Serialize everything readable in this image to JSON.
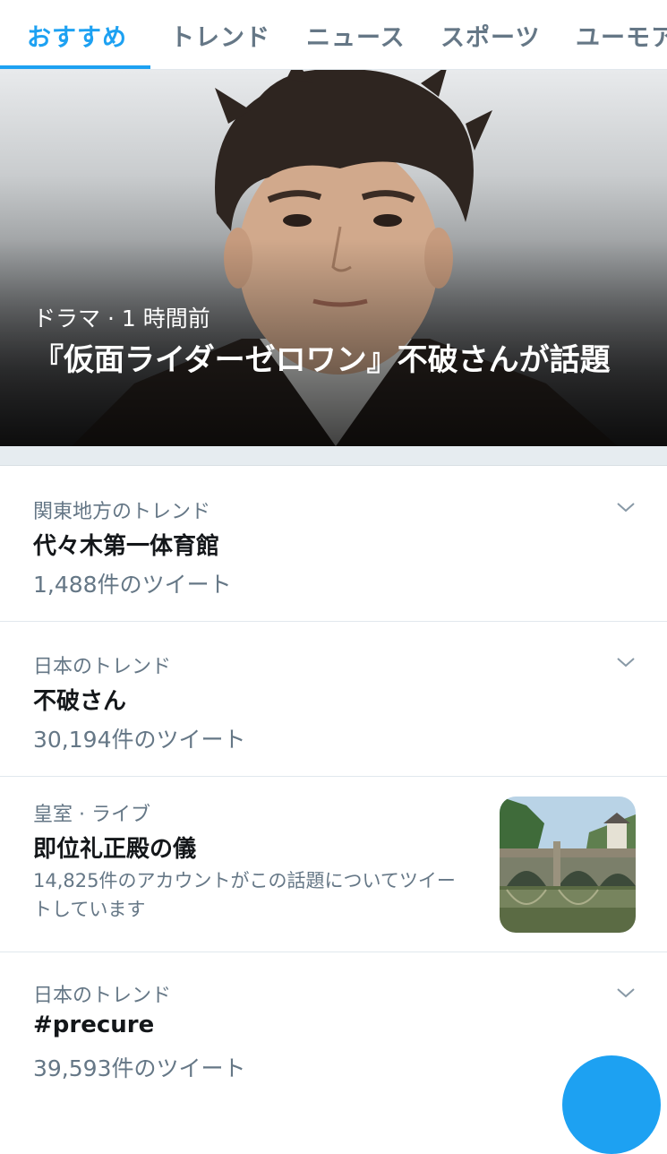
{
  "tabs": [
    {
      "label": "おすすめ",
      "active": true
    },
    {
      "label": "トレンド",
      "active": false
    },
    {
      "label": "ニュース",
      "active": false
    },
    {
      "label": "スポーツ",
      "active": false
    },
    {
      "label": "ユーモア",
      "active": false
    }
  ],
  "hero": {
    "meta": "ドラマ · 1 時間前",
    "title": "『仮面ライダーゼロワン』不破さんが話題"
  },
  "trends": [
    {
      "context": "関東地方のトレンド",
      "name": "代々木第一体育館",
      "count": "1,488件のツイート",
      "icon": "chevron-down-icon"
    },
    {
      "context": "日本のトレンド",
      "name": "不破さん",
      "count": "30,194件のツイート",
      "icon": "chevron-down-icon"
    },
    {
      "context": "皇室 · ライブ",
      "name": "即位礼正殿の儀",
      "description": "14,825件のアカウントがこの話題についてツイートしています"
    },
    {
      "context": "日本のトレンド",
      "name": "#precure",
      "count": "39,593件のツイート",
      "icon": "chevron-down-icon"
    }
  ],
  "colors": {
    "accent": "#1da1f2",
    "secondary_text": "#657786",
    "primary_text": "#14171a",
    "separator": "#e6ecf0"
  }
}
